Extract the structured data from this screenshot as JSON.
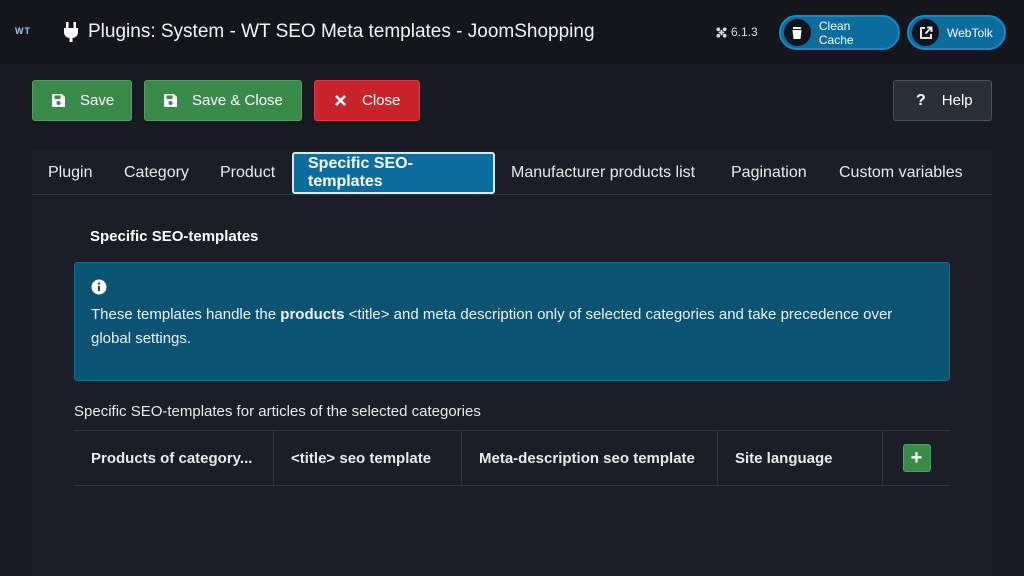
{
  "header": {
    "logo": "WT",
    "title": "Plugins: System - WT SEO Meta templates - JoomShopping",
    "version": "6.1.3",
    "clean_cache_label": "Clean Cache",
    "webtolk_label": "WebTolk"
  },
  "toolbar": {
    "save_label": "Save",
    "save_close_label": "Save & Close",
    "close_label": "Close",
    "help_label": "Help"
  },
  "tabs": [
    {
      "label": "Plugin"
    },
    {
      "label": "Category"
    },
    {
      "label": "Product"
    },
    {
      "label": "Specific SEO-templates",
      "active": true
    },
    {
      "label": "Manufacturer products list"
    },
    {
      "label": "Pagination"
    },
    {
      "label": "Custom variables"
    }
  ],
  "section": {
    "title": "Specific SEO-templates",
    "alert": {
      "before": "These templates handle the ",
      "bold": "products",
      "after": " <title> and meta description only of selected categories and take precedence over global settings."
    },
    "table_caption": "Specific SEO-templates for articles of the selected categories",
    "columns": [
      "Products of category...",
      "<title> seo template",
      "Meta-description seo template",
      "Site language"
    ],
    "add_label": "+"
  },
  "colors": {
    "accent": "#0a6d9e",
    "success": "#3a8a4a",
    "danger": "#c9232c",
    "background": "#171a21"
  },
  "icons": {
    "plug": "plug-icon",
    "joomla": "joomla-icon",
    "trash": "trash-icon",
    "external": "external-link-icon",
    "save": "save-icon",
    "close": "close-icon",
    "help": "question-icon",
    "info": "info-icon"
  }
}
